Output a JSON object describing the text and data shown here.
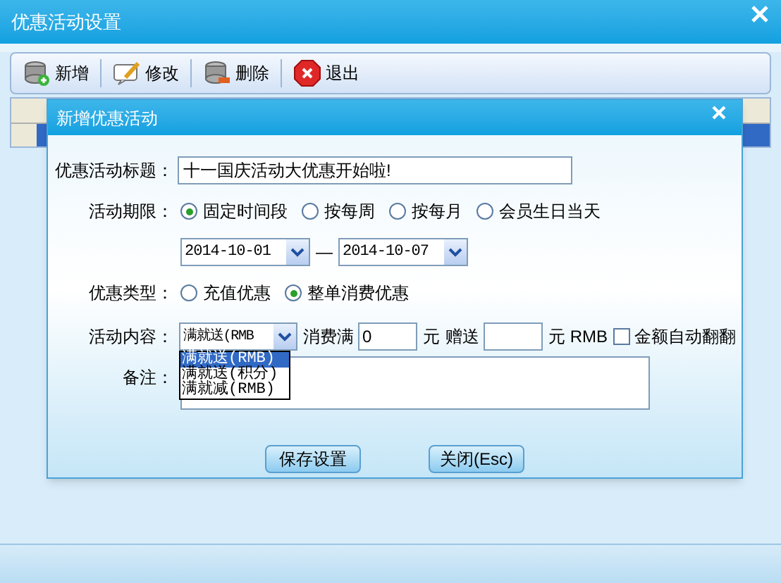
{
  "window": {
    "title": "优惠活动设置"
  },
  "toolbar": [
    {
      "label": "新增",
      "kind": "add"
    },
    {
      "label": "修改",
      "kind": "edit"
    },
    {
      "label": "删除",
      "kind": "delete"
    },
    {
      "label": "退出",
      "kind": "exit"
    }
  ],
  "dialog": {
    "title": "新增优惠活动",
    "title_label": "优惠活动标题：",
    "title_value": "十一国庆活动大优惠开始啦!",
    "period_label": "活动期限：",
    "period_options": [
      {
        "label": "固定时间段",
        "selected": true
      },
      {
        "label": "按每周",
        "selected": false
      },
      {
        "label": "按每月",
        "selected": false
      },
      {
        "label": "会员生日当天",
        "selected": false
      }
    ],
    "date_from": "2014-10-01",
    "date_separator": "—",
    "date_to": "2014-10-07",
    "type_label": "优惠类型：",
    "type_options": [
      {
        "label": "充值优惠",
        "selected": false
      },
      {
        "label": "整单消费优惠",
        "selected": true
      }
    ],
    "content_label": "活动内容：",
    "content_value": "满就送(RMB",
    "content_options": [
      {
        "label": "满就送(RMB)",
        "selected": true
      },
      {
        "label": "满就送(积分)",
        "selected": false
      },
      {
        "label": "满就减(RMB)",
        "selected": false
      }
    ],
    "spend_label": "消费满",
    "spend_value": "0",
    "spend_unit": "元",
    "gift_label": "赠送",
    "gift_unit": "元 RMB",
    "auto_double": {
      "label": "金额自动翻翻",
      "checked": false
    },
    "remark_label": "备注：",
    "buttons": [
      "保存设置",
      "关闭(Esc)"
    ]
  }
}
